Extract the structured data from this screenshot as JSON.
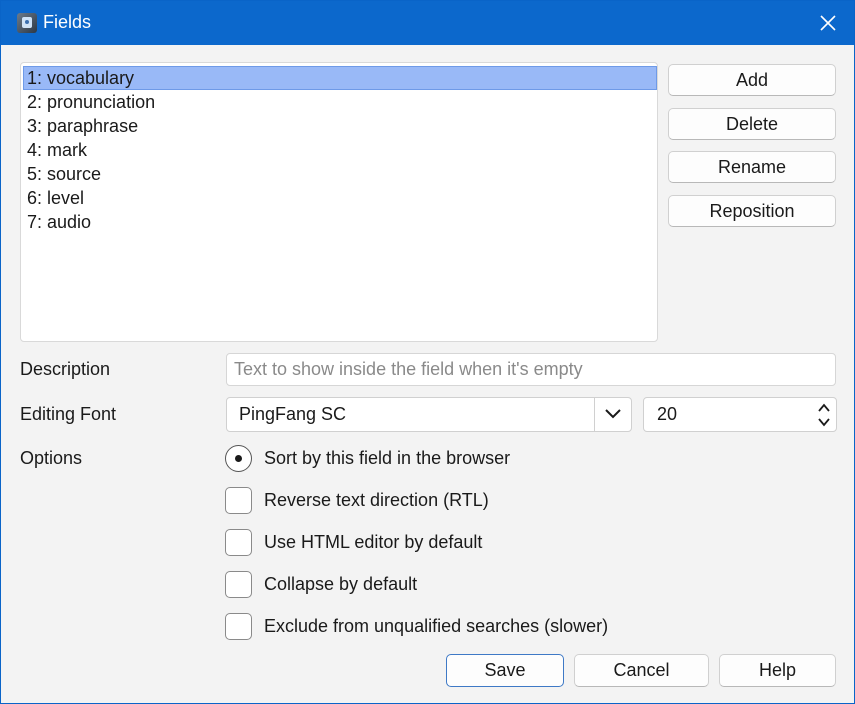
{
  "window": {
    "title": "Fields"
  },
  "fields": [
    "1: vocabulary",
    "2: pronunciation",
    "3: paraphrase",
    "4: mark",
    "5: source",
    "6: level",
    "7: audio"
  ],
  "selected_field_index": 0,
  "side_buttons": {
    "add": "Add",
    "delete": "Delete",
    "rename": "Rename",
    "reposition": "Reposition"
  },
  "description": {
    "label": "Description",
    "value": "",
    "placeholder": "Text to show inside the field when it's empty"
  },
  "editing_font": {
    "label": "Editing Font",
    "font": "PingFang SC",
    "size": "20"
  },
  "options": {
    "label": "Options",
    "sort_by_field": {
      "label": "Sort by this field in the browser",
      "selected": true
    },
    "rtl": {
      "label": "Reverse text direction (RTL)",
      "checked": false
    },
    "html_editor": {
      "label": "Use HTML editor by default",
      "checked": false
    },
    "collapse": {
      "label": "Collapse by default",
      "checked": false
    },
    "exclude_search": {
      "label": "Exclude from unqualified searches (slower)",
      "checked": false
    }
  },
  "bottom_buttons": {
    "save": "Save",
    "cancel": "Cancel",
    "help": "Help"
  },
  "colors": {
    "titlebar": "#0c68cc",
    "selection": "#99b9f7",
    "background": "#f3f3f3"
  },
  "icons": {
    "app": "anki-app-icon",
    "close": "close-icon",
    "dropdown": "chevron-down-icon",
    "spin_up": "chevron-up-icon",
    "spin_down": "chevron-down-icon"
  }
}
